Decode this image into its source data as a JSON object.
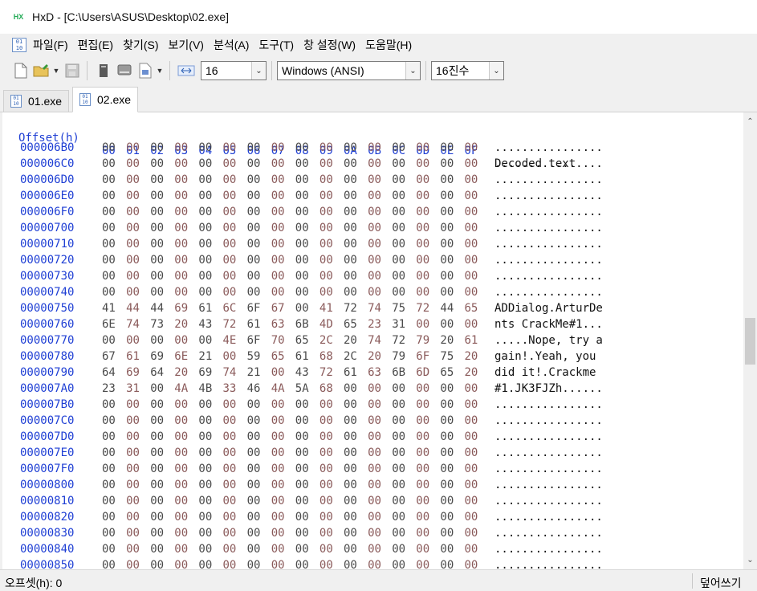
{
  "window": {
    "title": "HxD - [C:\\Users\\ASUS\\Desktop\\02.exe]",
    "app_icon": "hxd-app-icon",
    "app_icon_text": "HX"
  },
  "menu": {
    "doc_icon_text": "01\n10",
    "items": [
      "파일(F)",
      "편집(E)",
      "찾기(S)",
      "보기(V)",
      "분석(A)",
      "도구(T)",
      "창 설정(W)",
      "도움말(H)"
    ]
  },
  "toolbar": {
    "bytes_per_row": "16",
    "charset": "Windows (ANSI)",
    "number_base": "16진수",
    "icons": [
      "new-file-icon",
      "open-folder-icon",
      "save-icon",
      "close-file-icon",
      "open-disk-icon",
      "open-ram-icon",
      "bytes-per-row-icon"
    ]
  },
  "tabs": [
    {
      "label": "01.exe",
      "active": false
    },
    {
      "label": "02.exe",
      "active": true
    }
  ],
  "hex_view": {
    "offset_header": "Offset(h)",
    "column_headers": [
      "00",
      "01",
      "02",
      "03",
      "04",
      "05",
      "06",
      "07",
      "08",
      "09",
      "0A",
      "0B",
      "0C",
      "0D",
      "0E",
      "0F"
    ],
    "decoded_header": "Decoded text",
    "rows": [
      {
        "offset": "000006B0",
        "bytes": "00 00 00 00 00 00 00 00 00 00 00 00 00 00 00 00",
        "text": "................"
      },
      {
        "offset": "000006C0",
        "bytes": "00 00 00 00 00 00 00 00 00 00 00 00 00 00 00 00",
        "text": "................"
      },
      {
        "offset": "000006D0",
        "bytes": "00 00 00 00 00 00 00 00 00 00 00 00 00 00 00 00",
        "text": "................"
      },
      {
        "offset": "000006E0",
        "bytes": "00 00 00 00 00 00 00 00 00 00 00 00 00 00 00 00",
        "text": "................"
      },
      {
        "offset": "000006F0",
        "bytes": "00 00 00 00 00 00 00 00 00 00 00 00 00 00 00 00",
        "text": "................"
      },
      {
        "offset": "00000700",
        "bytes": "00 00 00 00 00 00 00 00 00 00 00 00 00 00 00 00",
        "text": "................"
      },
      {
        "offset": "00000710",
        "bytes": "00 00 00 00 00 00 00 00 00 00 00 00 00 00 00 00",
        "text": "................"
      },
      {
        "offset": "00000720",
        "bytes": "00 00 00 00 00 00 00 00 00 00 00 00 00 00 00 00",
        "text": "................"
      },
      {
        "offset": "00000730",
        "bytes": "00 00 00 00 00 00 00 00 00 00 00 00 00 00 00 00",
        "text": "................"
      },
      {
        "offset": "00000740",
        "bytes": "00 00 00 00 00 00 00 00 00 00 00 00 00 00 00 00",
        "text": "................"
      },
      {
        "offset": "00000750",
        "bytes": "41 44 44 69 61 6C 6F 67 00 41 72 74 75 72 44 65",
        "text": "ADDialog.ArturDe"
      },
      {
        "offset": "00000760",
        "bytes": "6E 74 73 20 43 72 61 63 6B 4D 65 23 31 00 00 00",
        "text": "nts CrackMe#1..."
      },
      {
        "offset": "00000770",
        "bytes": "00 00 00 00 00 4E 6F 70 65 2C 20 74 72 79 20 61",
        "text": ".....Nope, try a"
      },
      {
        "offset": "00000780",
        "bytes": "67 61 69 6E 21 00 59 65 61 68 2C 20 79 6F 75 20",
        "text": "gain!.Yeah, you "
      },
      {
        "offset": "00000790",
        "bytes": "64 69 64 20 69 74 21 00 43 72 61 63 6B 6D 65 20",
        "text": "did it!.Crackme "
      },
      {
        "offset": "000007A0",
        "bytes": "23 31 00 4A 4B 33 46 4A 5A 68 00 00 00 00 00 00",
        "text": "#1.JK3FJZh......"
      },
      {
        "offset": "000007B0",
        "bytes": "00 00 00 00 00 00 00 00 00 00 00 00 00 00 00 00",
        "text": "................"
      },
      {
        "offset": "000007C0",
        "bytes": "00 00 00 00 00 00 00 00 00 00 00 00 00 00 00 00",
        "text": "................"
      },
      {
        "offset": "000007D0",
        "bytes": "00 00 00 00 00 00 00 00 00 00 00 00 00 00 00 00",
        "text": "................"
      },
      {
        "offset": "000007E0",
        "bytes": "00 00 00 00 00 00 00 00 00 00 00 00 00 00 00 00",
        "text": "................"
      },
      {
        "offset": "000007F0",
        "bytes": "00 00 00 00 00 00 00 00 00 00 00 00 00 00 00 00",
        "text": "................"
      },
      {
        "offset": "00000800",
        "bytes": "00 00 00 00 00 00 00 00 00 00 00 00 00 00 00 00",
        "text": "................"
      },
      {
        "offset": "00000810",
        "bytes": "00 00 00 00 00 00 00 00 00 00 00 00 00 00 00 00",
        "text": "................"
      },
      {
        "offset": "00000820",
        "bytes": "00 00 00 00 00 00 00 00 00 00 00 00 00 00 00 00",
        "text": "................"
      },
      {
        "offset": "00000830",
        "bytes": "00 00 00 00 00 00 00 00 00 00 00 00 00 00 00 00",
        "text": "................"
      },
      {
        "offset": "00000840",
        "bytes": "00 00 00 00 00 00 00 00 00 00 00 00 00 00 00 00",
        "text": "................"
      },
      {
        "offset": "00000850",
        "bytes": "00 00 00 00 00 00 00 00 00 00 00 00 00 00 00 00",
        "text": "................"
      }
    ]
  },
  "status": {
    "offset": "오프셋(h): 0",
    "mode": "덮어쓰기"
  },
  "colors": {
    "offset_blue": "#1f3fd4",
    "byte_even": "#4a4a4a",
    "byte_odd": "#8a5a5a"
  }
}
